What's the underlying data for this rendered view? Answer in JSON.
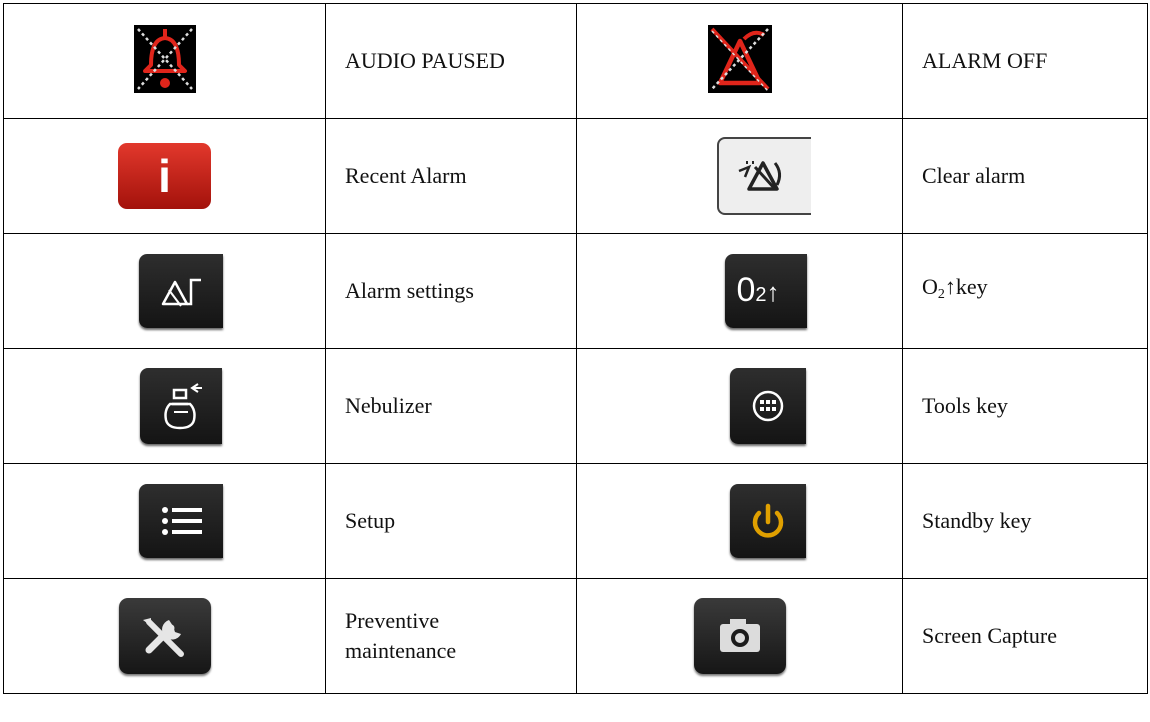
{
  "rows": [
    {
      "left": {
        "icon": "audio-paused-icon",
        "label": "AUDIO PAUSED"
      },
      "right": {
        "icon": "alarm-off-icon",
        "label": "ALARM OFF"
      }
    },
    {
      "left": {
        "icon": "recent-alarm-icon",
        "label": "Recent Alarm"
      },
      "right": {
        "icon": "clear-alarm-icon",
        "label": "Clear alarm"
      }
    },
    {
      "left": {
        "icon": "alarm-settings-icon",
        "label": "Alarm settings"
      },
      "right": {
        "icon": "o2-up-icon",
        "label_main": "O",
        "label_sub": "2",
        "label_rest": "↑key",
        "key_text": "0",
        "key_sub": "2",
        "key_arrow": "↑"
      }
    },
    {
      "left": {
        "icon": "nebulizer-icon",
        "label": "Nebulizer"
      },
      "right": {
        "icon": "tools-icon",
        "label": "Tools key"
      }
    },
    {
      "left": {
        "icon": "setup-icon",
        "label": "Setup"
      },
      "right": {
        "icon": "standby-icon",
        "label": "Standby key"
      }
    },
    {
      "left": {
        "icon": "preventive-maintenance-icon",
        "label_line1": "Preventive",
        "label_line2": "maintenance"
      },
      "right": {
        "icon": "camera-icon",
        "label": "Screen Capture"
      }
    }
  ],
  "recent_alarm_glyph": "i",
  "colors": {
    "alarm_red": "#e0251b",
    "standby_orange": "#e0a000"
  }
}
